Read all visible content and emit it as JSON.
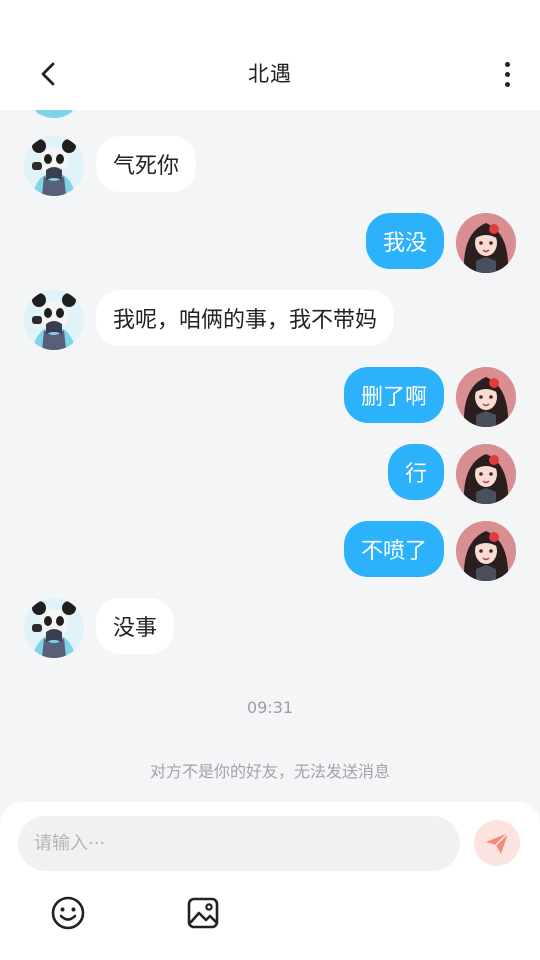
{
  "header": {
    "title": "北遇"
  },
  "messages": [
    {
      "side": "left",
      "avatar": "panda-avatar",
      "text": ""
    },
    {
      "side": "left",
      "avatar": "panda-avatar",
      "text": "气死你"
    },
    {
      "side": "right",
      "avatar": "girl-avatar",
      "text": "我没"
    },
    {
      "side": "left",
      "avatar": "panda-avatar",
      "text": "我呢，咱俩的事，我不带妈"
    },
    {
      "side": "right",
      "avatar": "girl-avatar",
      "text": "删了啊"
    },
    {
      "side": "right",
      "avatar": "girl-avatar",
      "text": "行"
    },
    {
      "side": "right",
      "avatar": "girl-avatar",
      "text": "不喷了"
    },
    {
      "side": "left",
      "avatar": "panda-avatar",
      "text": "没事"
    }
  ],
  "timestamp": "09:31",
  "notice": "对方不是你的好友，无法发送消息",
  "composer": {
    "placeholder": "请输入···",
    "value": ""
  },
  "icons": {
    "back": "chevron-left-icon",
    "more": "more-vertical-icon",
    "send": "send-icon",
    "emoji": "emoji-icon",
    "image": "image-icon"
  },
  "colors": {
    "sent_bubble": "#2cb2fb",
    "received_bubble": "#ffffff",
    "chat_background": "#f4f5f7",
    "send_button_bg": "#fde3df",
    "send_icon": "#f48a7a"
  }
}
